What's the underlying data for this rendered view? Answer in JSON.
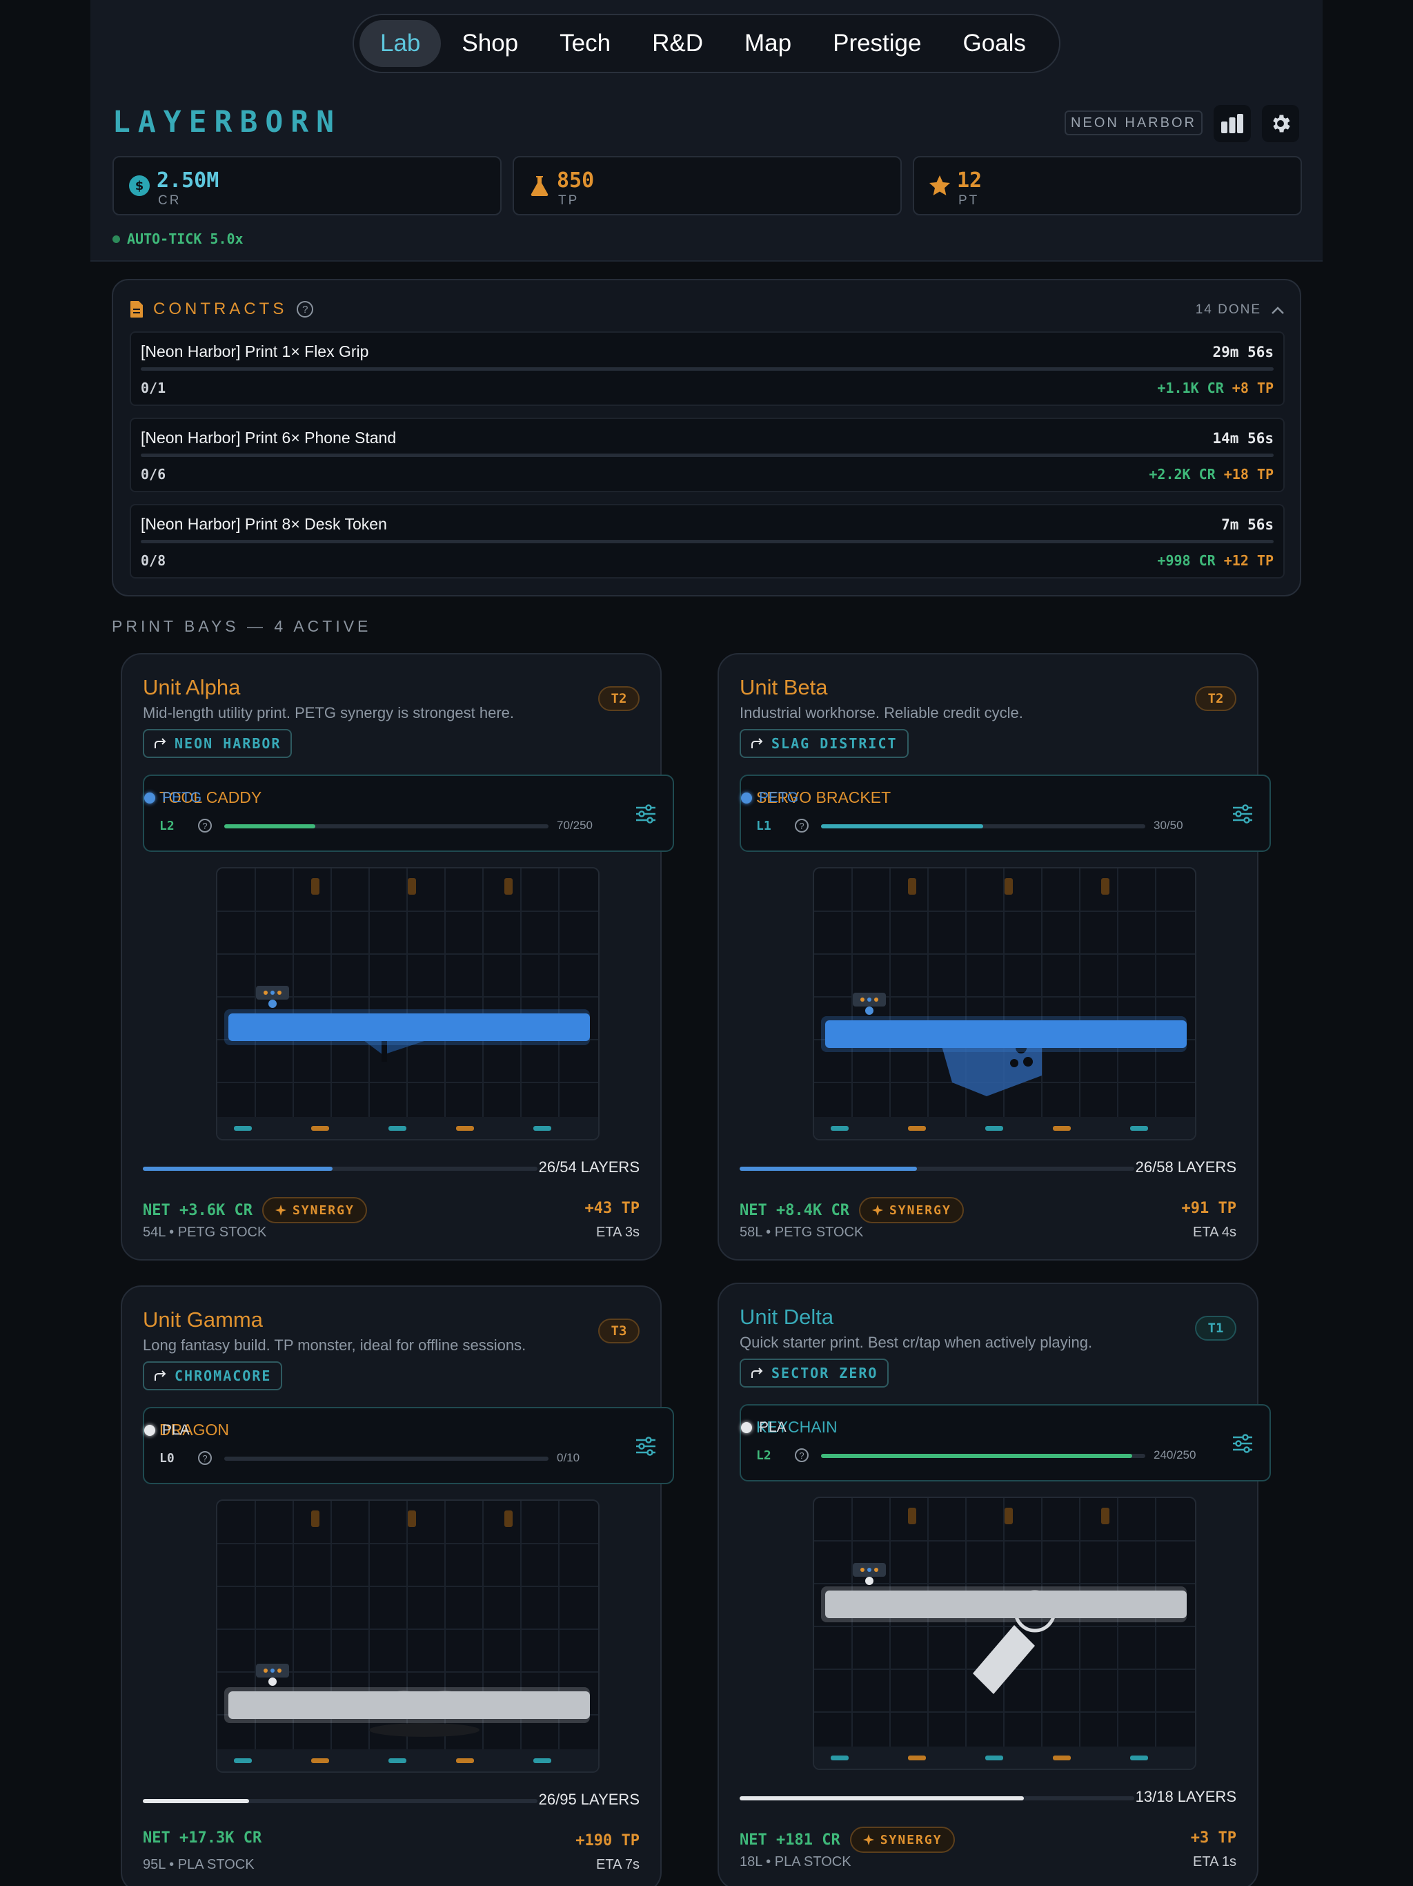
{
  "nav": {
    "tabs": [
      "Lab",
      "Shop",
      "Tech",
      "R&D",
      "Map",
      "Prestige",
      "Goals"
    ],
    "active": "Lab"
  },
  "header": {
    "brand": "LAYERBORN",
    "location": "NEON HARBOR",
    "stats": [
      {
        "value": "2.50M",
        "label": "CR",
        "icon": "credit-coin-icon",
        "color": "#5ec8de"
      },
      {
        "value": "850",
        "label": "TP",
        "icon": "flask-icon",
        "color": "#e0922f"
      },
      {
        "value": "12",
        "label": "PT",
        "icon": "star-icon",
        "color": "#e0922f"
      }
    ],
    "autotick": "AUTO-TICK 5.0x"
  },
  "contracts": {
    "title": "CONTRACTS",
    "done": "14 DONE",
    "items": [
      {
        "name": "[Neon Harbor] Print 1× Flex Grip",
        "time": "29m 56s",
        "progress": "0/1",
        "reward_cr": "+1.1K CR",
        "reward_tp": "+8 TP"
      },
      {
        "name": "[Neon Harbor] Print 6× Phone Stand",
        "time": "14m 56s",
        "progress": "0/6",
        "reward_cr": "+2.2K CR",
        "reward_tp": "+18 TP"
      },
      {
        "name": "[Neon Harbor] Print 8× Desk Token",
        "time": "7m 56s",
        "progress": "0/8",
        "reward_cr": "+998 CR",
        "reward_tp": "+12 TP"
      }
    ]
  },
  "bays_title": "PRINT BAYS — 4 ACTIVE",
  "units": [
    {
      "name": "Unit Alpha",
      "desc": "Mid-length utility print. PETG synergy is strongest here.",
      "tier": "T2",
      "zone": "NEON HARBOR",
      "job": "TOOL CADDY",
      "material": "PETG",
      "level": "L2",
      "xp": "70/250",
      "xp_fraction": 0.28,
      "layers": "26/54 LAYERS",
      "layer_fraction": 0.48,
      "net": "NET +3.6K CR",
      "synergy": "SYNERGY",
      "tp": "+43 TP",
      "stock": "54L  •  PETG STOCK",
      "eta": "ETA 3s"
    },
    {
      "name": "Unit Beta",
      "desc": "Industrial workhorse. Reliable credit cycle.",
      "tier": "T2",
      "zone": "SLAG DISTRICT",
      "job": "SERVO BRACKET",
      "material": "PETG",
      "level": "L1",
      "xp": "30/50",
      "xp_fraction": 0.5,
      "layers": "26/58 LAYERS",
      "layer_fraction": 0.45,
      "net": "NET +8.4K CR",
      "synergy": "SYNERGY",
      "tp": "+91 TP",
      "stock": "58L  •  PETG STOCK",
      "eta": "ETA 4s"
    },
    {
      "name": "Unit Gamma",
      "desc": "Long fantasy build. TP monster, ideal for offline sessions.",
      "tier": "T3",
      "zone": "CHROMACORE",
      "job": "DRAGON",
      "material": "PLA",
      "level": "L0",
      "xp": "0/10",
      "xp_fraction": 0,
      "layers": "26/95 LAYERS",
      "layer_fraction": 0.27,
      "net": "NET +17.3K CR",
      "synergy": "",
      "tp": "+190 TP",
      "stock": "95L  •  PLA STOCK",
      "eta": "ETA 7s"
    },
    {
      "name": "Unit Delta",
      "desc": "Quick starter print. Best cr/tap when actively playing.",
      "tier": "T1",
      "zone": "SECTOR ZERO",
      "job": "KEYCHAIN",
      "material": "PLA",
      "level": "L2",
      "xp": "240/250",
      "xp_fraction": 0.96,
      "layers": "13/18 LAYERS",
      "layer_fraction": 0.72,
      "net": "NET +181 CR",
      "synergy": "SYNERGY",
      "tp": "+3 TP",
      "stock": "18L  •  PLA STOCK",
      "eta": "ETA 1s"
    }
  ]
}
